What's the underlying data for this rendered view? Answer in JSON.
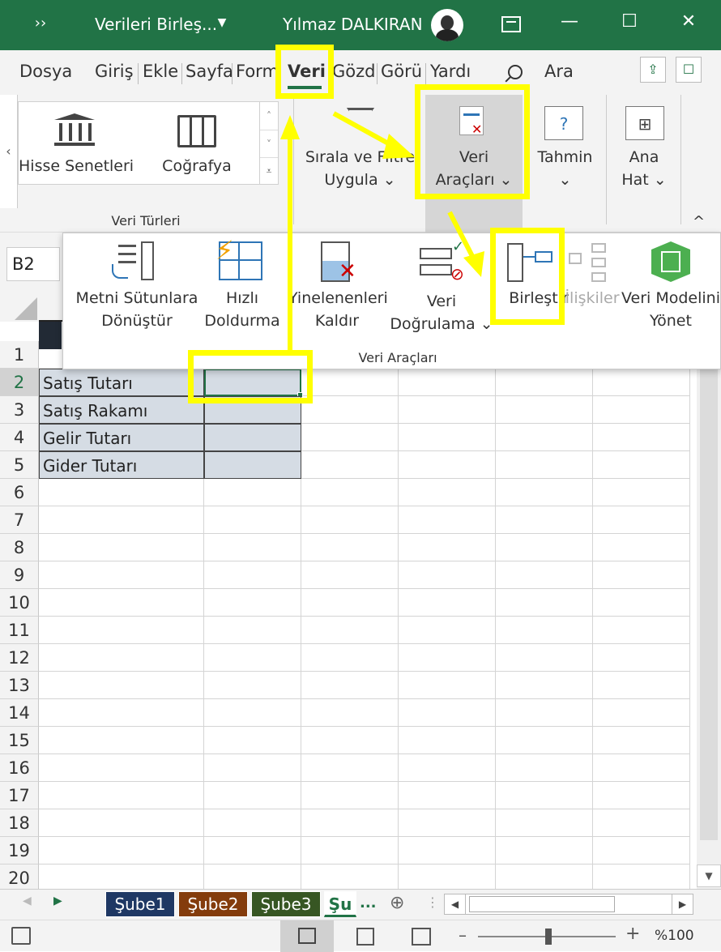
{
  "window": {
    "title": "Verileri Birleş...",
    "user": "Yılmaz DALKIRAN",
    "more_glyph": "››",
    "dropdown_glyph": "▼",
    "min_glyph": "—",
    "max_glyph": "☐",
    "close_glyph": "✕",
    "icons": [
      "overflow-icon",
      "title-dropdown-icon",
      "avatar",
      "ribbon-display-icon",
      "minimize-icon",
      "maximize-icon",
      "close-icon"
    ]
  },
  "tabs": [
    "Dosya",
    "Giriş",
    "Ekle",
    "Sayfa",
    "Form",
    "Veri",
    "Gözd",
    "Görü",
    "Yardı"
  ],
  "search_label": "Ara",
  "ribbon": {
    "gallery_items": [
      "Hisse Senetleri",
      "Coğrafya"
    ],
    "gallery_group_label": "Veri Türleri",
    "sort_filter": [
      "Sırala ve Filtre",
      "Uygula ⌄"
    ],
    "data_tools": [
      "Veri",
      "Araçları ⌄"
    ],
    "forecast": [
      "Tahmin",
      "⌄"
    ],
    "outline": [
      "Ana",
      "Hat ⌄"
    ],
    "collapse_glyph": "^"
  },
  "namebox": "B2",
  "dropdown": {
    "items": [
      {
        "l1": "Metni Sütunlara",
        "l2": "Dönüştür"
      },
      {
        "l1": "Hızlı",
        "l2": "Doldurma"
      },
      {
        "l1": "Yinelenenleri",
        "l2": "Kaldır"
      },
      {
        "l1": "Veri",
        "l2": "Doğrulama ⌄"
      },
      {
        "l1": "Birleştir",
        "l2": ""
      },
      {
        "l1": "İlişkiler",
        "l2": ""
      },
      {
        "l1": "Veri Modelini",
        "l2": "Yönet"
      }
    ],
    "group_label": "Veri Araçları"
  },
  "rows": [
    "1",
    "2",
    "3",
    "4",
    "5",
    "6",
    "7",
    "8",
    "9",
    "10",
    "11",
    "12",
    "13",
    "14",
    "15",
    "16",
    "17",
    "18",
    "19",
    "20"
  ],
  "cells": {
    "a2": "Satış Tutarı",
    "a3": "Satış Rakamı",
    "a4": "Gelir Tutarı",
    "a5": "Gider Tutarı"
  },
  "sheets": [
    {
      "name": "Şube1",
      "color": "#1f3864"
    },
    {
      "name": "Şube2",
      "color": "#843c0c"
    },
    {
      "name": "Şube3",
      "color": "#375623"
    },
    {
      "name": "Şu",
      "color": "#ffffff"
    }
  ],
  "sheet_more": "...",
  "add_sheet_glyph": "⊕",
  "zoom": "%100",
  "colors": {
    "excel_green": "#217346",
    "highlight": "#ffff00"
  }
}
